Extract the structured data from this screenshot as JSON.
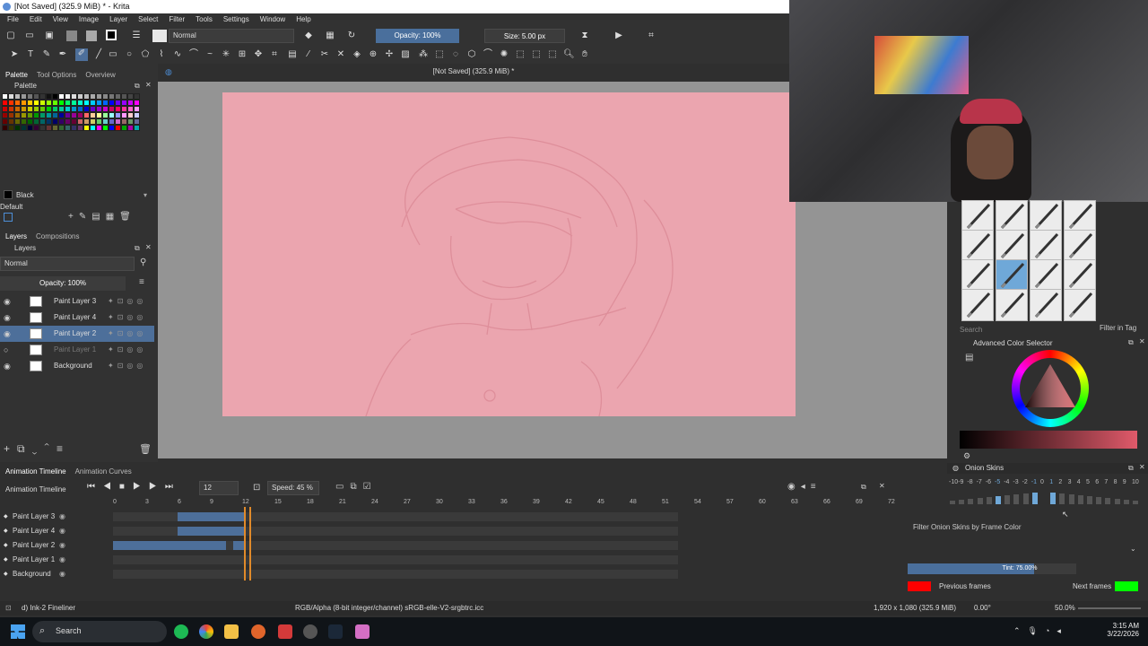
{
  "window": {
    "title": "[Not Saved]  (325.9 MiB) * - Krita"
  },
  "menu": [
    "File",
    "Edit",
    "View",
    "Image",
    "Layer",
    "Select",
    "Filter",
    "Tools",
    "Settings",
    "Window",
    "Help"
  ],
  "toolbar": {
    "blend_mode": "Normal",
    "opacity": "Opacity: 100%",
    "opacity_level": 1.0,
    "size": "Size: 5.00 px"
  },
  "canvas": {
    "header": "[Not Saved]  (325.9 MiB) *",
    "background_color": "#eba5af"
  },
  "left_dock": {
    "tabs": [
      "Palette",
      "Tool Options",
      "Overview"
    ],
    "palette_title": "Palette",
    "color_name": "Black",
    "palette_set": "Default",
    "layers_tabs": [
      "Layers",
      "Compositions"
    ],
    "layer_blend": "Normal",
    "layer_opacity": "Opacity: 100%",
    "layers": [
      {
        "name": "Paint Layer 3",
        "selected": false,
        "visible": true
      },
      {
        "name": "Paint Layer 4",
        "selected": false,
        "visible": true
      },
      {
        "name": "Paint Layer 2",
        "selected": true,
        "visible": true
      },
      {
        "name": "Paint Layer 1",
        "selected": false,
        "visible": false
      },
      {
        "name": "Background",
        "selected": false,
        "visible": true
      }
    ]
  },
  "right_dock": {
    "search_placeholder": "Search",
    "filter_in_tag": "Filter in Tag",
    "color_selector_title": "Advanced Color Selector",
    "onion_title": "Onion Skins",
    "onion_numbers": [
      "-10",
      "-9",
      "-8",
      "-7",
      "-6",
      "-5",
      "-4",
      "-3",
      "-2",
      "-1",
      "0",
      "1",
      "2",
      "3",
      "4",
      "5",
      "6",
      "7",
      "8",
      "9",
      "10"
    ],
    "filter_onion": "Filter Onion Skins by Frame Color",
    "tint": "Tint: 75.00%",
    "tint_level": 0.75,
    "previous_frames": "Previous frames",
    "next_frames": "Next frames",
    "previous_color": "#ff0000",
    "next_color": "#00ff00"
  },
  "timeline": {
    "tabs": [
      "Animation Timeline",
      "Animation Curves"
    ],
    "title": "Animation Timeline",
    "current_frame": "12",
    "speed": "Speed: 45 %",
    "ticks": [
      "0",
      "3",
      "6",
      "9",
      "12",
      "15",
      "18",
      "21",
      "24",
      "27",
      "30",
      "33",
      "36",
      "39",
      "42",
      "45",
      "48",
      "51",
      "54",
      "57",
      "60",
      "63",
      "66",
      "69",
      "72"
    ],
    "rows": [
      "Paint Layer 3",
      "Paint Layer 4",
      "Paint Layer 2",
      "Paint Layer 1",
      "Background"
    ]
  },
  "status": {
    "brush": "d) Ink-2 Fineliner",
    "color_space": "RGB/Alpha (8-bit integer/channel)  sRGB-elle-V2-srgbtrc.icc",
    "dims": "1,920 x 1,080 (325.9 MiB)",
    "rotation": "0.00°",
    "zoom": "50.0%"
  },
  "taskbar": {
    "search": "Search",
    "time": "3:15 AM",
    "date": "3/22/2026"
  }
}
